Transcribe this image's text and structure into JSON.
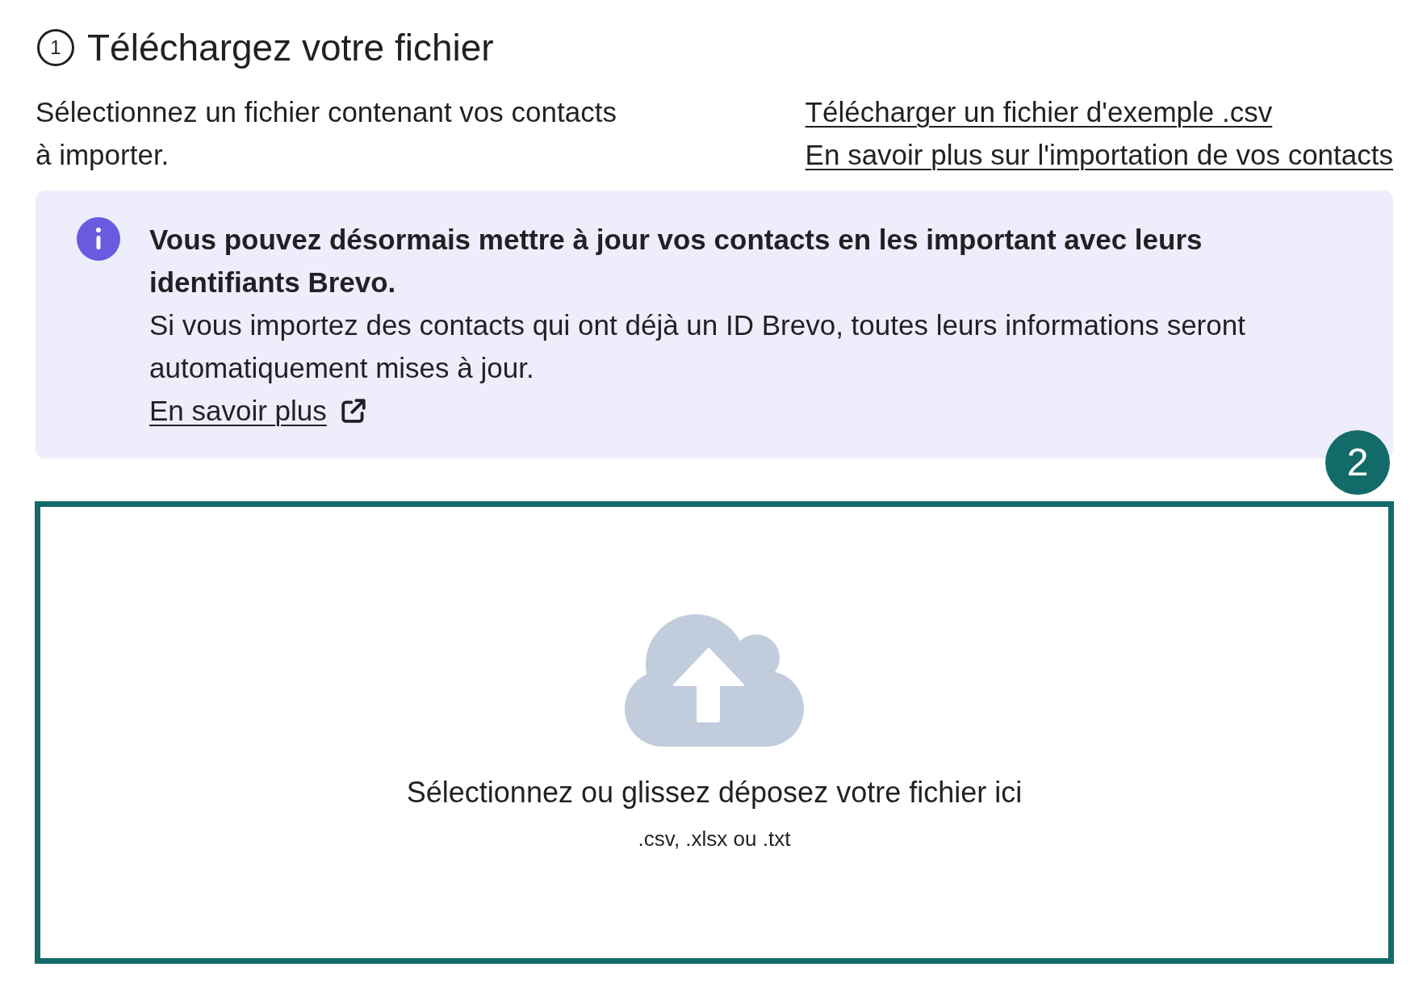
{
  "section": {
    "step": "1",
    "title": "Téléchargez votre fichier",
    "description": "Sélectionnez un fichier contenant vos contacts à importer.",
    "links": [
      "Télécharger un fichier d'exemple .csv",
      "En savoir plus sur l'importation de vos contacts"
    ]
  },
  "info_banner": {
    "heading": "Vous pouvez désormais mettre à jour vos contacts en les important avec leurs identifiants Brevo.",
    "body": "Si vous importez des contacts qui ont déjà un ID Brevo, toutes leurs informations seront automatiquement mises à jour.",
    "link": "En savoir plus"
  },
  "step_marker": "2",
  "drop_zone": {
    "prompt": "Sélectionnez ou glissez déposez votre fichier ici",
    "formats": ".csv, .xlsx ou .txt"
  }
}
